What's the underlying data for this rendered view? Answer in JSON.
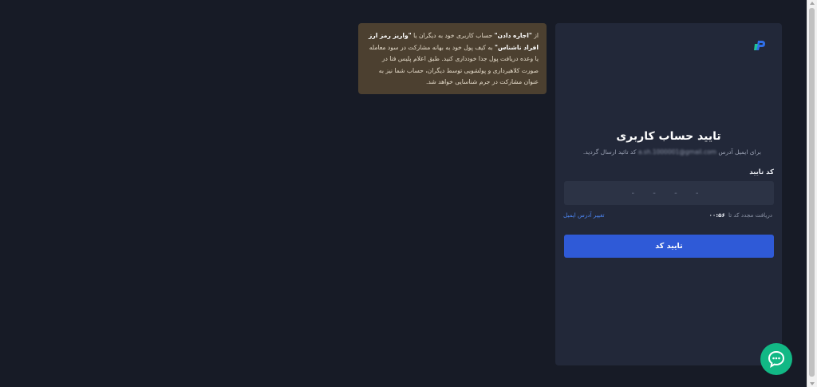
{
  "warning": {
    "p1": "از ",
    "b1": "\"اجاره دادن\"",
    "p2": " حساب کاربری خود به دیگران یا ",
    "b2": "\"واریز رمز ارز افراد ناشناس\"",
    "p3": " به کیف پول خود به بهانه مشارکت در سود معامله یا وعده دریافت پول جدا خودداری کنید. طبق اعلام پلیس فتا در صورت کلاهبرداری و پولشویی توسط دیگران، حساب شما نیز به عنوان مشارکت در جرم شناسایی خواهد شد."
  },
  "verify": {
    "title": "تایید حساب کاربری",
    "subtitle_pre": "برای ایمیل آدرس",
    "email": "a.sh.1000001@gmail.com",
    "subtitle_post": "کد تائید ارسال گردید.",
    "code_label": "کد تایید",
    "code_placeholder": "- - - -",
    "resend_label": "دریافت مجدد کد تا",
    "timer": "۰۰:۵۶",
    "change_email": "تغییر آدرس ایمیل",
    "confirm_button": "تایید کد"
  },
  "colors": {
    "background": "#171b26",
    "panel": "#222839",
    "warning_bg": "#4c4030",
    "primary": "#2f5ad7",
    "link": "#4d86f2",
    "chat": "#12b885"
  },
  "icons": {
    "logo": "brand-logo-icon",
    "chat": "chat-bubble-icon"
  }
}
